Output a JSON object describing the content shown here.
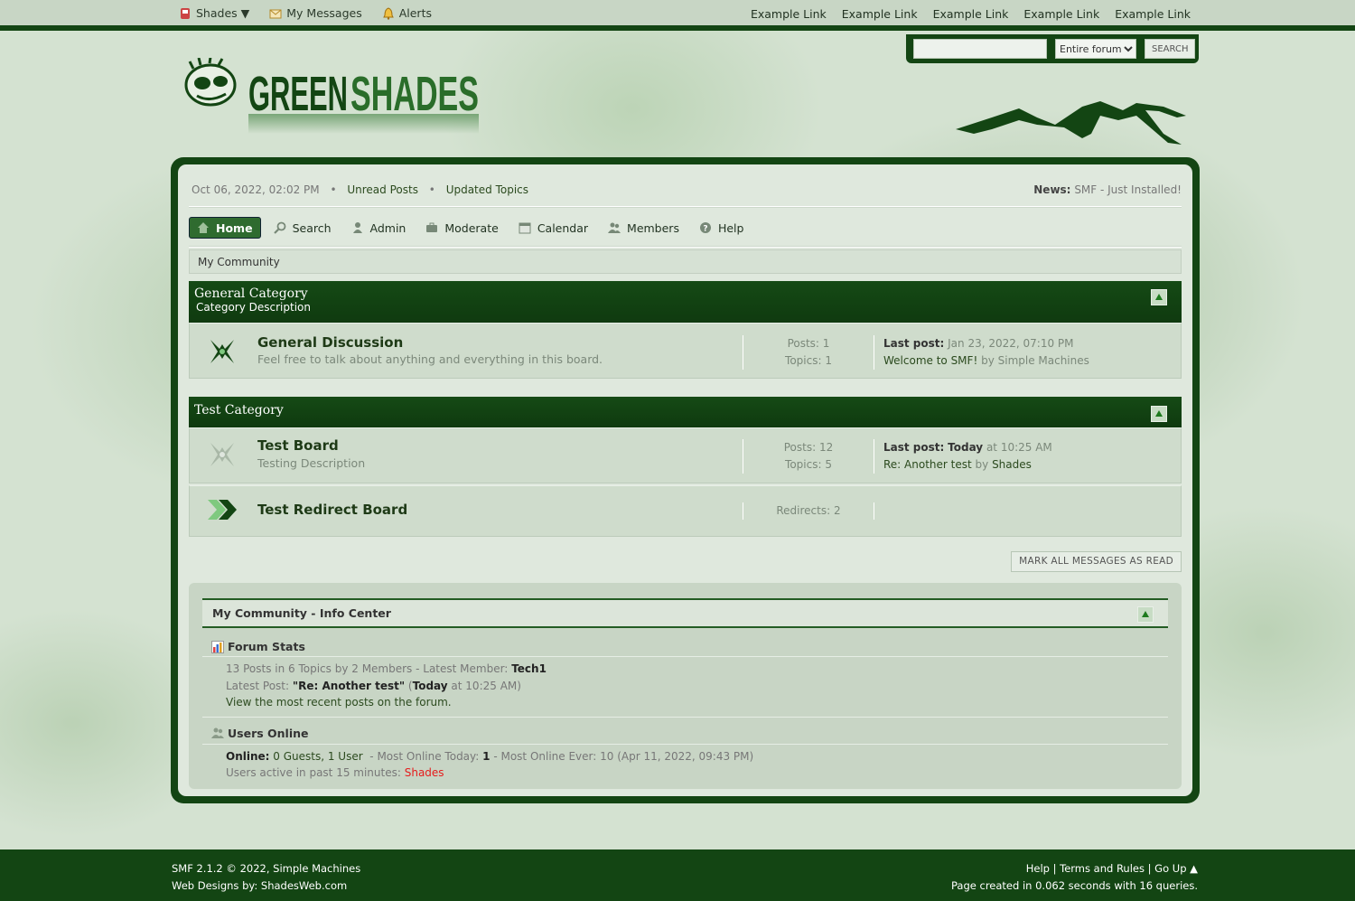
{
  "topbar": {
    "user_menu": {
      "name": "Shades ▼",
      "messages": "My Messages",
      "alerts": "Alerts"
    },
    "links": [
      "Example Link",
      "Example Link",
      "Example Link",
      "Example Link",
      "Example Link"
    ]
  },
  "search": {
    "placeholder": "",
    "scope": "Entire forum",
    "button": "SEARCH"
  },
  "logo": {
    "text_green": "GREEN",
    "text_shades": "SHADES"
  },
  "infobar": {
    "date": "Oct 06, 2022, 02:02 PM",
    "unread": "Unread Posts",
    "updated": "Updated Topics",
    "news_label": "News:",
    "news_text": "SMF - Just Installed!"
  },
  "nav": {
    "home": "Home",
    "search": "Search",
    "admin": "Admin",
    "moderate": "Moderate",
    "calendar": "Calendar",
    "members": "Members",
    "help": "Help"
  },
  "breadcrumb": "My Community",
  "categories": [
    {
      "title": "General Category",
      "description": "Category Description",
      "boards": [
        {
          "name": "General Discussion",
          "description": "Feel free to talk about anything and everything in this board.",
          "posts": "Posts: 1",
          "topics": "Topics: 1",
          "last_label": "Last post:",
          "last_date": "Jan 23, 2022, 07:10 PM",
          "last_topic": "Welcome to SMF!",
          "last_by": "by Simple Machines"
        }
      ]
    },
    {
      "title": "Test Category",
      "boards": [
        {
          "name": "Test Board",
          "description": "Testing Description",
          "posts": "Posts: 12",
          "topics": "Topics: 5",
          "last_label": "Last post:",
          "last_today": "Today",
          "last_time": "at 10:25 AM",
          "last_topic": "Re: Another test",
          "last_by_label": "by",
          "last_by_user": "Shades"
        },
        {
          "name": "Test Redirect Board",
          "redirects": "Redirects: 2"
        }
      ]
    }
  ],
  "mark_read": "MARK ALL MESSAGES AS READ",
  "info_center": {
    "title": "My Community - Info Center",
    "stats_title": "Forum Stats",
    "stats_line1": "13 Posts in 6 Topics by 2 Members - Latest Member:",
    "latest_member": "Tech1",
    "latest_post_label": "Latest Post:",
    "latest_post": "\"Re: Another test\"",
    "latest_post_open": "(",
    "latest_post_today": "Today",
    "latest_post_time": "at 10:25 AM)",
    "recent_link": "View the most recent posts on the forum.",
    "online_title": "Users Online",
    "online_label": "Online:",
    "online_counts": "0 Guests, 1 User",
    "most_today_label": "- Most Online Today:",
    "most_today": "1",
    "most_ever": "- Most Online Ever: 10 (Apr 11, 2022, 09:43 PM)",
    "active_label": "Users active in past 15 minutes:",
    "active_user": "Shades"
  },
  "footer": {
    "version": "SMF 2.1.2 © 2022,",
    "sm": "Simple Machines",
    "designs_label": "Web Designs by:",
    "designs": "ShadesWeb.com",
    "help": "Help",
    "terms": "Terms and Rules",
    "goup": "Go Up ▲",
    "created": "Page created in 0.062 seconds with 16 queries."
  },
  "colors": {
    "brand_dark": "#134513",
    "accent": "#2f6b2f",
    "online_user": "#e51b1b"
  }
}
